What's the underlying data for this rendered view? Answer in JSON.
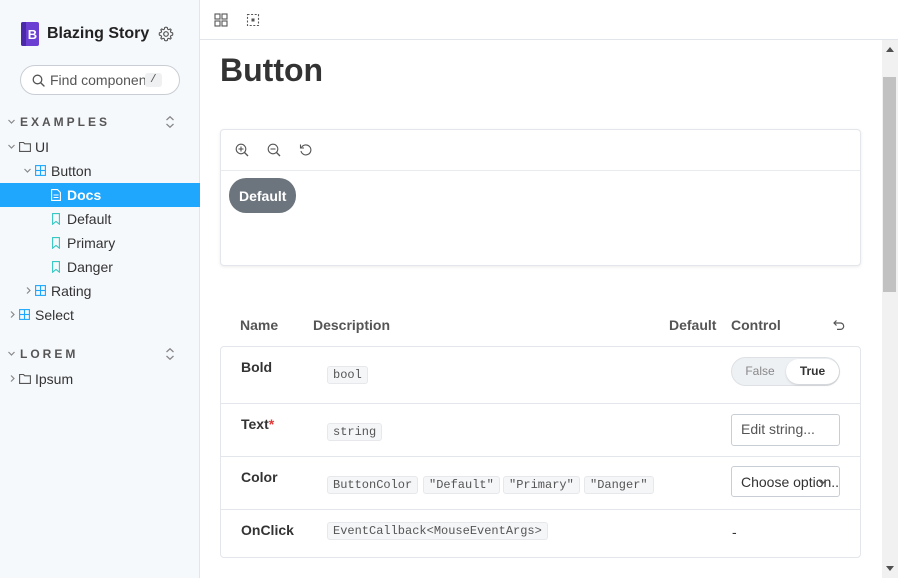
{
  "brand": {
    "name": "Blazing Story"
  },
  "search": {
    "placeholder": "Find components",
    "shortcut": "/"
  },
  "sidebar": {
    "sections": [
      {
        "label": "EXAMPLES"
      },
      {
        "label": "LOREM"
      }
    ],
    "tree": {
      "ui": "UI",
      "button": "Button",
      "docs": "Docs",
      "default": "Default",
      "primary": "Primary",
      "danger": "Danger",
      "rating": "Rating",
      "select": "Select",
      "ipsum": "Ipsum"
    }
  },
  "page": {
    "title": "Button"
  },
  "preview": {
    "button_label": "Default"
  },
  "props_table": {
    "headers": {
      "name": "Name",
      "description": "Description",
      "default": "Default",
      "control": "Control"
    },
    "rows": [
      {
        "name": "Bold",
        "required": "",
        "types": [
          "bool"
        ],
        "control": {
          "type": "toggle",
          "options": [
            "False",
            "True"
          ],
          "selected": "True"
        }
      },
      {
        "name": "Text",
        "required": "*",
        "types": [
          "string"
        ],
        "control": {
          "type": "text",
          "placeholder": "Edit string..."
        }
      },
      {
        "name": "Color",
        "required": "",
        "types": [
          "ButtonColor",
          "\"Default\"",
          "\"Primary\"",
          "\"Danger\""
        ],
        "control": {
          "type": "select",
          "value": "Choose option..."
        }
      },
      {
        "name": "OnClick",
        "required": "",
        "types": [
          "EventCallback<MouseEventArgs>"
        ],
        "control": {
          "type": "none",
          "value": "-"
        }
      }
    ]
  },
  "colors": {
    "accent": "#1ea7fd",
    "demo_button": "#6c757d",
    "required": "#e53935"
  }
}
